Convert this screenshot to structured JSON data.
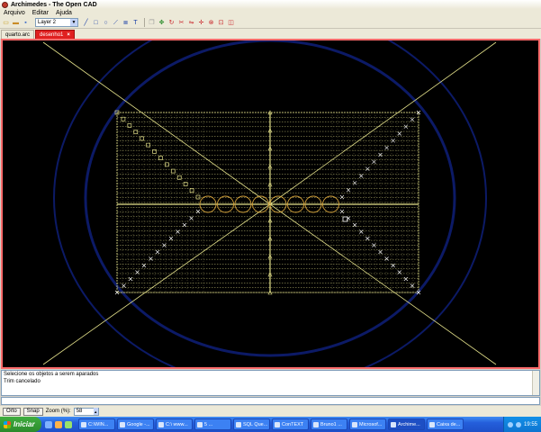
{
  "window": {
    "title": "Archimedes - The Open CAD"
  },
  "menu": {
    "items": [
      "Arquivo",
      "Editar",
      "Ajuda"
    ]
  },
  "toolbar": {
    "layer_value": "Layer 2",
    "icons": [
      "new-file-icon",
      "open-file-icon",
      "save-file-icon",
      "undo-icon",
      "line-icon",
      "rectangle-icon",
      "circle-icon",
      "polyline-icon",
      "dimension-icon",
      "text-icon",
      "copy-icon",
      "move-icon",
      "rotate-icon",
      "trim-icon",
      "mirror-icon",
      "snap-icon",
      "delete-icon",
      "zoom-icon",
      "offset-icon"
    ]
  },
  "tabs": [
    {
      "label": "quarto.arc",
      "active": false
    },
    {
      "label": "desenho1",
      "active": true
    }
  ],
  "console": {
    "lines": [
      "Selecione os objetos a serem aparados",
      "Trim cancelado"
    ]
  },
  "status": {
    "orto_label": "Orto",
    "snap_label": "Snap",
    "zoom_label": "Zoom (%):",
    "zoom_value": "58"
  },
  "taskbar": {
    "start_label": "Iniciar",
    "tasks": [
      "C:\\WIN...",
      "Google -...",
      "C:\\ www...",
      "5 ...",
      "SQL Que...",
      "ConTEXT",
      "Bruno1 ...",
      "Microsof...",
      "Archime...",
      "Caixa de..."
    ],
    "active_task_index": 8,
    "clock": "19:55"
  },
  "colors": {
    "canvas_bg": "#000000",
    "drawing_color": "#e3e08a",
    "accent_circles": "#d2a03a",
    "frame_border": "#ff6b6b",
    "blue_arc": "#0c1a66"
  }
}
